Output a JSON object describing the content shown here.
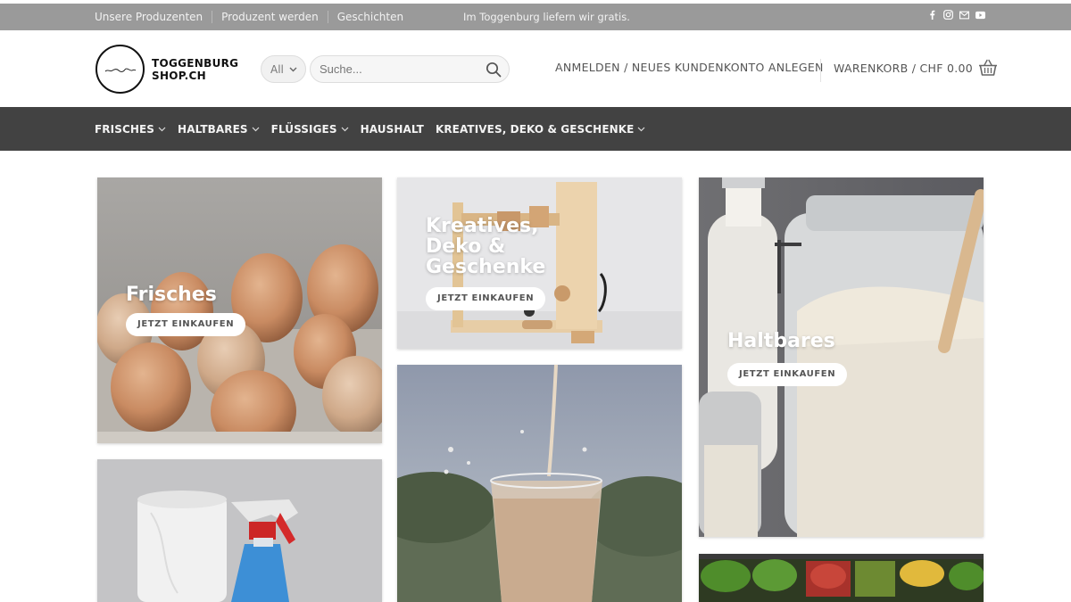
{
  "topbar": {
    "links": [
      "Unsere Produzenten",
      "Produzent werden",
      "Geschichten"
    ],
    "notice": "Im Toggenburg liefern wir gratis.",
    "social_icons": [
      "facebook-icon",
      "instagram-icon",
      "email-icon",
      "youtube-icon"
    ]
  },
  "header": {
    "logo_line1": "TOGGENBURG",
    "logo_line2": "SHOP.CH",
    "category_select": "All",
    "search_placeholder": "Suche...",
    "account_link": "ANMELDEN / NEUES KUNDENKONTO ANLEGEN",
    "cart_label": "WARENKORB / CHF 0.00"
  },
  "nav": {
    "items": [
      {
        "label": "FRISCHES",
        "dropdown": true
      },
      {
        "label": "HALTBARES",
        "dropdown": true
      },
      {
        "label": "FLÜSSIGES",
        "dropdown": true
      },
      {
        "label": "HAUSHALT",
        "dropdown": false
      },
      {
        "label": "KREATIVES, DEKO & GESCHENKE",
        "dropdown": true
      }
    ]
  },
  "tiles": {
    "frisches": {
      "title": "Frisches",
      "button": "JETZT EINKAUFEN"
    },
    "kreatives": {
      "title_lines": [
        "Kreatives,",
        "Deko &",
        "Geschenke"
      ],
      "button": "JETZT EINKAUFEN"
    },
    "haltbares": {
      "title": "Haltbares",
      "button": "JETZT EINKAUFEN"
    }
  },
  "colors": {
    "topbar": "#9a9a9a",
    "nav": "#424242",
    "text": "#555555"
  }
}
